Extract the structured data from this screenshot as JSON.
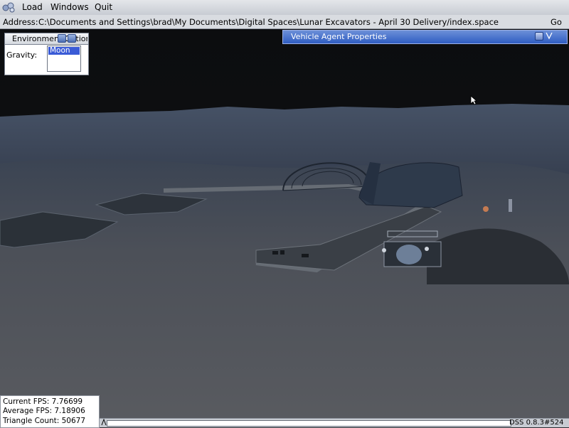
{
  "menubar": {
    "items": [
      "Load",
      "Windows",
      "Quit"
    ]
  },
  "address": {
    "label": "Address:",
    "value": "C:\\Documents and Settings\\brad\\My Documents\\Digital Spaces\\Lunar Excavators - April 30 Delivery/index.space",
    "go_label": "Go"
  },
  "environment_window": {
    "title": "Environment Options",
    "gravity_label": "Gravity:",
    "gravity_selected": "Moon"
  },
  "vehicle_window": {
    "title": "Vehicle Agent Properties"
  },
  "stats": {
    "current_fps": "Current FPS: 7.76699",
    "average_fps": "Average FPS: 7.18906",
    "triangle_count": "Triangle Count: 50677"
  },
  "statusbar": {
    "version": "DSS 0.8.3#524"
  },
  "icons": {
    "logo": "app-logo-icon",
    "minimize": "minimize-icon",
    "close": "close-icon",
    "collapse": "chevron-down-icon",
    "cursor": "mouse-cursor-icon"
  },
  "colors": {
    "sky": "#0d0e10",
    "terrain": "#4a4d53",
    "window_title_active": "#3d63c7",
    "selection": "#3a5bd6"
  }
}
